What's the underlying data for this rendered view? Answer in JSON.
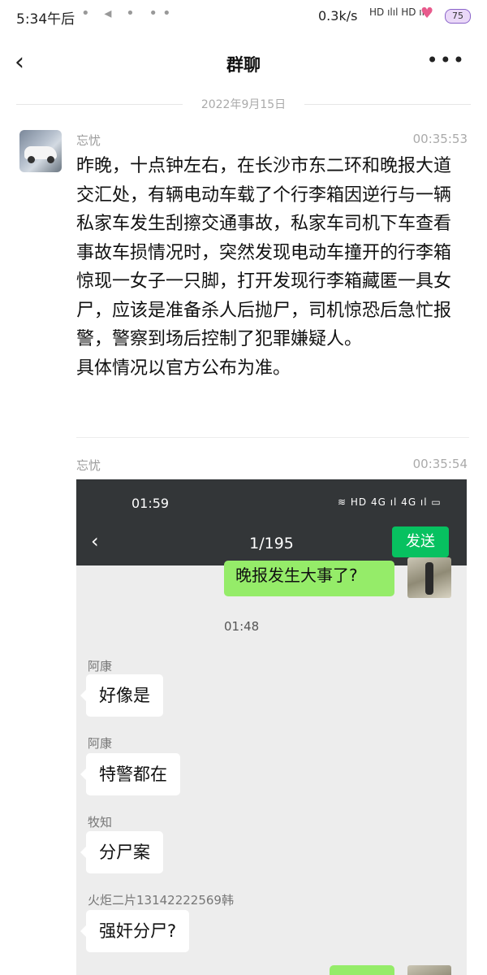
{
  "status_bar": {
    "time": "5:34午后",
    "network_speed": "0.3k/s",
    "signal_text": "HD ılıl HD ılıl",
    "battery": "75"
  },
  "nav": {
    "title": "群聊"
  },
  "date_divider": "2022年9月15日",
  "messages": [
    {
      "sender": "忘忧",
      "time": "00:35:53",
      "text": "昨晚，十点钟左右，在长沙市东二环和晚报大道交汇处，有辆电动车载了个行李箱因逆行与一辆私家车发生刮擦交通事故，私家车司机下车查看事故车损情况时，突然发现电动车撞开的行李箱惊现一女子一只脚，打开发现行李箱藏匿一具女尸，应该是准备杀人后抛尸，司机惊恐后急忙报警，警察到场后控制了犯罪嫌疑人。\n具体情况以官方公布为准。"
    },
    {
      "sender": "忘忧",
      "time": "00:35:54"
    }
  ],
  "screenshot": {
    "time": "01:59",
    "icons": "≋ HD 4G ıl 4G ıl ▭",
    "title": "1/195",
    "send_label": "发送",
    "my_message": "晚报发生大事了?",
    "timestamp": "01:48",
    "chats": [
      {
        "sender": "阿康",
        "text": "好像是"
      },
      {
        "sender": "阿康",
        "text": "特警都在"
      },
      {
        "sender": "牧知",
        "text": "分尸案"
      },
      {
        "sender": "火炬二片13142222569韩",
        "text": "强奸分尸?"
      }
    ]
  }
}
